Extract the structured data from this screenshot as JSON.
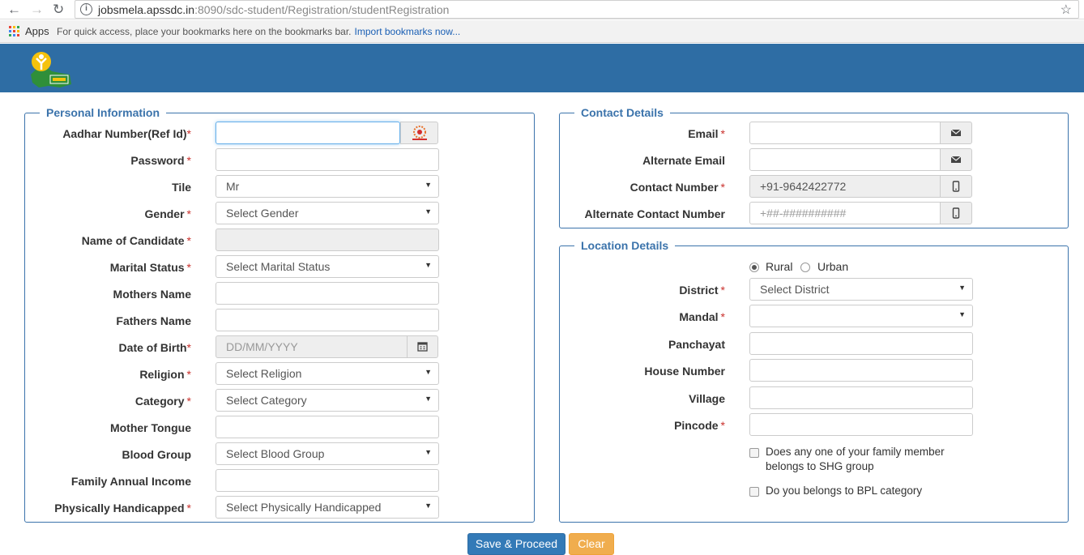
{
  "browser": {
    "url_host": "jobsmela.apssdc.in",
    "url_path": ":8090/sdc-student/Registration/studentRegistration",
    "apps_label": "Apps",
    "bookmark_hint": "For quick access, place your bookmarks here on the bookmarks bar.",
    "import_link": "Import bookmarks now..."
  },
  "colors": {
    "header": "#2e6da4",
    "primary": "#337ab7",
    "warning": "#f0ad4e",
    "required": "#c9302c",
    "legend": "#3b73ab"
  },
  "personal": {
    "legend": "Personal Information",
    "aadhar_label": "Aadhar Number(Ref Id)",
    "password_label": "Password",
    "title_label": "Tile",
    "title_value": "Mr",
    "gender_label": "Gender",
    "gender_value": "Select Gender",
    "name_label": "Name of Candidate",
    "marital_label": "Marital Status",
    "marital_value": "Select Marital Status",
    "mothers_label": "Mothers Name",
    "fathers_label": "Fathers Name",
    "dob_label": "Date of Birth",
    "dob_placeholder": "DD/MM/YYYY",
    "religion_label": "Religion",
    "religion_value": "Select Religion",
    "category_label": "Category",
    "category_value": "Select Category",
    "tongue_label": "Mother Tongue",
    "blood_label": "Blood Group",
    "blood_value": "Select Blood Group",
    "income_label": "Family Annual Income",
    "handicap_label": "Physically Handicapped",
    "handicap_value": "Select Physically Handicapped"
  },
  "contact": {
    "legend": "Contact Details",
    "email_label": "Email",
    "alt_email_label": "Alternate Email",
    "contact_label": "Contact Number",
    "contact_value": "+91-9642422772",
    "alt_contact_label": "Alternate Contact Number",
    "alt_contact_placeholder": "+##-##########"
  },
  "location": {
    "legend": "Location Details",
    "rural_label": "Rural",
    "urban_label": "Urban",
    "area_selected": "Rural",
    "district_label": "District",
    "district_value": "Select District",
    "mandal_label": "Mandal",
    "mandal_value": "",
    "panchayat_label": "Panchayat",
    "house_label": "House Number",
    "village_label": "Village",
    "pincode_label": "Pincode",
    "shg_label": "Does any one of your family member belongs to SHG group",
    "bpl_label": "Do you belongs to BPL category"
  },
  "actions": {
    "save_label": "Save & Proceed",
    "clear_label": "Clear"
  },
  "icons": {
    "back": "arrow-left-icon",
    "forward": "arrow-right-icon",
    "reload": "reload-icon",
    "star": "star-icon",
    "email": "envelope-icon",
    "phone": "mobile-phone-icon",
    "calendar": "calendar-icon",
    "aadhaar": "aadhaar-logo-icon"
  }
}
